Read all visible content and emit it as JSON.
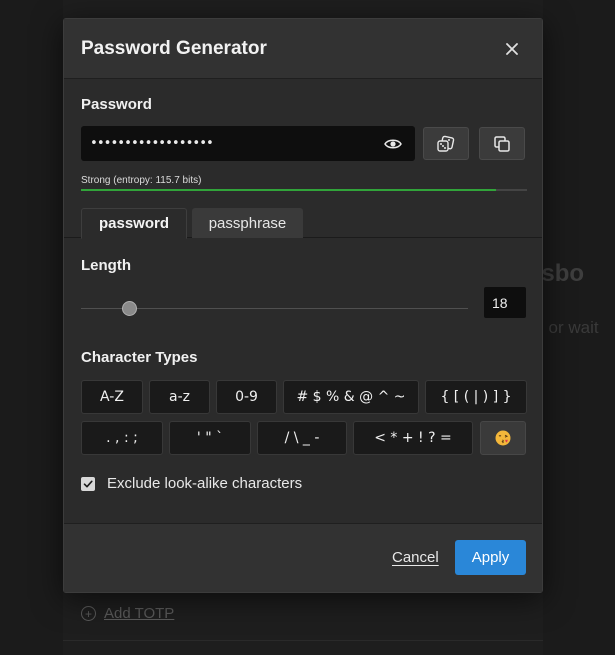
{
  "background": {
    "partial_title": "ssbo",
    "partial_text": "l or wait",
    "add_totp_label": "Add TOTP"
  },
  "dialog": {
    "title": "Password Generator",
    "close_icon": "close-icon"
  },
  "password": {
    "label": "Password",
    "value": "••••••••••••••••••",
    "show_icon": "eye-icon",
    "generate_icon": "dice-icon",
    "copy_icon": "copy-icon",
    "strength_text": "Strong (entropy: 115.7 bits)",
    "strength_fraction": 0.93,
    "strength_color": "#31a43a"
  },
  "tabs": [
    {
      "label": "password",
      "active": true
    },
    {
      "label": "passphrase",
      "active": false
    }
  ],
  "length": {
    "label": "Length",
    "value": "18",
    "slider_fraction": 0.1
  },
  "character_types": {
    "label": "Character Types",
    "row1": [
      "A-Z",
      "a-z",
      "0-9",
      "# $ % & @ ^ ~",
      "{ [ ( | ) ] }"
    ],
    "row2": [
      ". , : ;",
      "' \" `",
      "/ \\ _ -",
      "< * + ! ? =",
      "😘"
    ]
  },
  "exclude": {
    "label": "Exclude look-alike characters",
    "checked": true
  },
  "footer": {
    "cancel_label": "Cancel",
    "apply_label": "Apply",
    "apply_color": "#2a87d8"
  }
}
